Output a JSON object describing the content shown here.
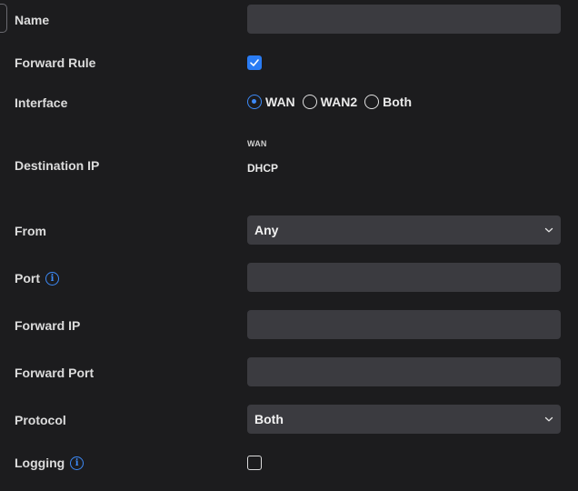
{
  "form": {
    "name": {
      "label": "Name",
      "value": ""
    },
    "forward_rule": {
      "label": "Forward Rule",
      "checked": true
    },
    "interface": {
      "label": "Interface",
      "options": [
        "WAN",
        "WAN2",
        "Both"
      ],
      "selected": "WAN"
    },
    "destination_ip": {
      "label": "Destination IP",
      "interface": "WAN",
      "value": "DHCP"
    },
    "from": {
      "label": "From",
      "value": "Any"
    },
    "port": {
      "label": "Port",
      "value": ""
    },
    "forward_ip": {
      "label": "Forward IP",
      "value": ""
    },
    "forward_port": {
      "label": "Forward Port",
      "value": ""
    },
    "protocol": {
      "label": "Protocol",
      "value": "Both"
    },
    "logging": {
      "label": "Logging",
      "checked": false
    }
  },
  "colors": {
    "background": "#1c1c1e",
    "field": "#3b3b40",
    "accent": "#3d8af7"
  },
  "icons": {
    "info": "info-icon",
    "chevron": "chevron-down-icon",
    "check": "check-icon"
  }
}
